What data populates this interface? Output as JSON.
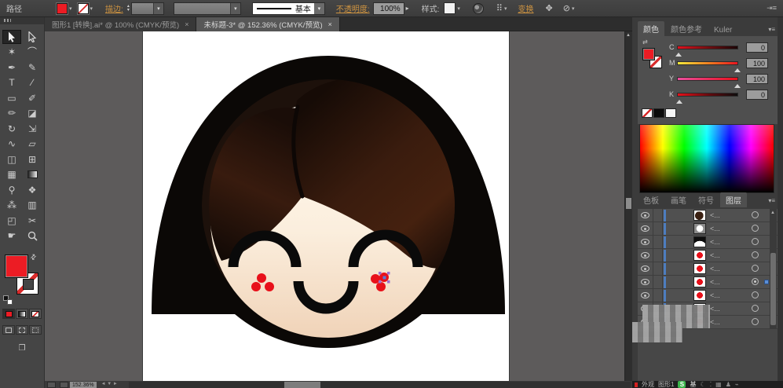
{
  "control_bar": {
    "selection_label": "路径",
    "stroke_label": "描边:",
    "brush_value": "基本",
    "opacity_label": "不透明度:",
    "opacity_value": "100%",
    "style_label": "样式:",
    "transform_label": "变换",
    "fill_color": "#ec1c24",
    "accent_color": "#cf9441"
  },
  "icons": {
    "chevron_down": "▾",
    "stepper_up": "▴",
    "stepper_down": "▾",
    "spin_right": "▸",
    "menu": "▾≡",
    "collapse": "⇥≡",
    "swap": "⇄",
    "scroll_up": "▲",
    "select_similar": "⠿",
    "isolate": "✥",
    "arrange": "⊘",
    "screen_mode": "❐"
  },
  "tabs": [
    {
      "title": "图形1 [转换].ai* @ 100% (CMYK/预览)",
      "close": "×"
    },
    {
      "title": "未标题-3* @ 152.36% (CMYK/预览)",
      "close": "×"
    }
  ],
  "toolbar": {
    "tools": [
      {
        "name": "selection-tool"
      },
      {
        "name": "direct-selection-tool"
      },
      {
        "name": "magic-wand-tool",
        "glyph": "✶"
      },
      {
        "name": "lasso-tool",
        "glyph": "⌒"
      },
      {
        "name": "pen-tool",
        "glyph": "✒"
      },
      {
        "name": "blob-brush-tool",
        "glyph": "✎"
      },
      {
        "name": "type-tool",
        "glyph": "T"
      },
      {
        "name": "line-segment-tool",
        "glyph": "∕"
      },
      {
        "name": "rectangle-tool",
        "glyph": "▭"
      },
      {
        "name": "paintbrush-tool",
        "glyph": "✐"
      },
      {
        "name": "pencil-tool",
        "glyph": "✏"
      },
      {
        "name": "eraser-tool",
        "glyph": "◪"
      },
      {
        "name": "rotate-tool",
        "glyph": "↻"
      },
      {
        "name": "scale-tool",
        "glyph": "⇲"
      },
      {
        "name": "width-tool",
        "glyph": "∿"
      },
      {
        "name": "free-transform-tool",
        "glyph": "▱"
      },
      {
        "name": "shape-builder-tool",
        "glyph": "◫"
      },
      {
        "name": "perspective-grid-tool",
        "glyph": "⊞"
      },
      {
        "name": "mesh-tool",
        "glyph": "▦"
      },
      {
        "name": "gradient-tool"
      },
      {
        "name": "eyedropper-tool",
        "glyph": "⚲"
      },
      {
        "name": "blend-tool",
        "glyph": "❖"
      },
      {
        "name": "symbol-sprayer-tool",
        "glyph": "⁂"
      },
      {
        "name": "graph-tool",
        "glyph": "▥"
      },
      {
        "name": "artboard-tool",
        "glyph": "◰"
      },
      {
        "name": "slice-tool",
        "glyph": "✂"
      },
      {
        "name": "hand-tool",
        "glyph": "☛"
      },
      {
        "name": "zoom-tool"
      }
    ]
  },
  "canvas": {
    "palette": {
      "outline": "#0b0806",
      "hair_dark": "#1d110b",
      "hair_brown": "#4f2718",
      "face_top": "#fffaf1",
      "face_bottom": "#f0d3b8",
      "features": "#0a0a0a",
      "blush": "#e8101a"
    }
  },
  "panels": {
    "color": {
      "tabs": [
        "颜色",
        "颜色参考",
        "Kuler"
      ],
      "sliders": [
        {
          "label": "C",
          "value": "0"
        },
        {
          "label": "M",
          "value": "100"
        },
        {
          "label": "Y",
          "value": "100"
        },
        {
          "label": "K",
          "value": "0"
        }
      ]
    },
    "dock_tabs": [
      "色板",
      "画笔",
      "符号",
      "图层"
    ],
    "layers": {
      "rows": [
        {
          "label": "<...",
          "thumb": "hair"
        },
        {
          "label": "<...",
          "thumb": "face"
        },
        {
          "label": "<...",
          "thumb": "arc"
        },
        {
          "label": "<...",
          "thumb": "dot"
        },
        {
          "label": "<...",
          "thumb": "dot"
        },
        {
          "label": "<...",
          "thumb": "dot"
        },
        {
          "label": "<...",
          "thumb": "dot"
        },
        {
          "label": "<...",
          "thumb": "dot"
        },
        {
          "label": "<...",
          "thumb": "dot"
        }
      ],
      "selected_row_index": 5
    }
  },
  "status_bar": {
    "zoom_value": "152.36%"
  },
  "taskbar": {
    "items": [
      "外观",
      "图形1"
    ],
    "ime_badge": "S",
    "ime_label": "基"
  }
}
